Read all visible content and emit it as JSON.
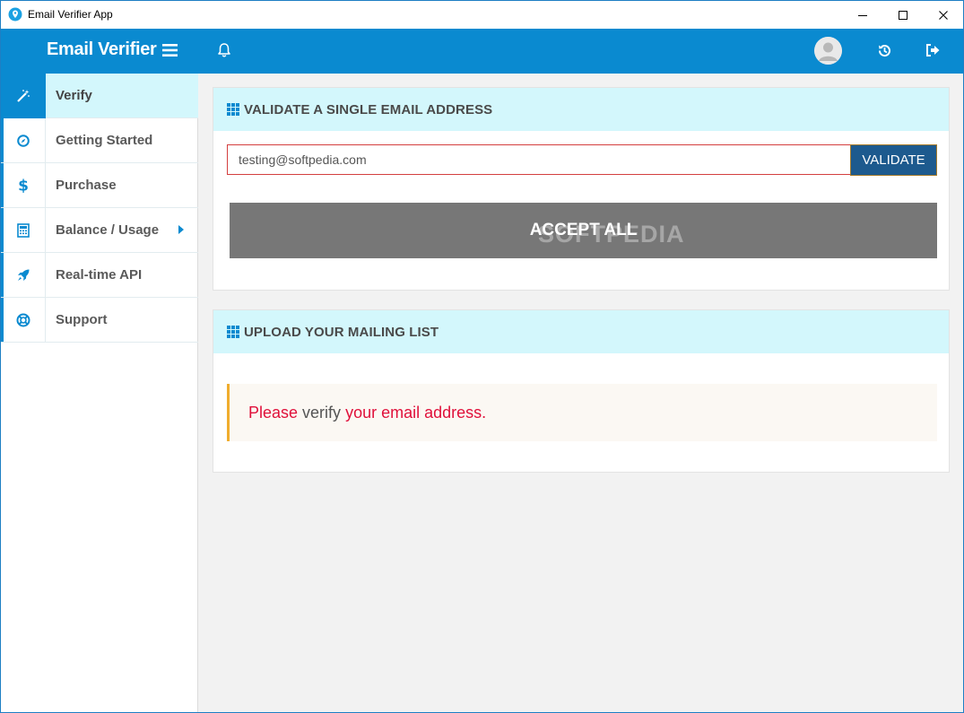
{
  "window": {
    "title": "Email Verifier App"
  },
  "header": {
    "brand": "Email Verifier"
  },
  "sidebar": {
    "items": [
      {
        "label": "Verify",
        "icon": "magic-wand-icon",
        "active": true
      },
      {
        "label": "Getting Started",
        "icon": "compass-icon"
      },
      {
        "label": "Purchase",
        "icon": "dollar-icon"
      },
      {
        "label": "Balance / Usage",
        "icon": "calculator-icon"
      },
      {
        "label": "Real-time API",
        "icon": "rocket-icon"
      },
      {
        "label": "Support",
        "icon": "lifebuoy-icon"
      }
    ]
  },
  "validate_panel": {
    "title": "VALIDATE A SINGLE EMAIL ADDRESS",
    "email_value": "testing@softpedia.com",
    "validate_label": "VALIDATE",
    "accept_all_label": "ACCEPT ALL",
    "watermark": "SOFTPEDIA"
  },
  "upload_panel": {
    "title": "UPLOAD YOUR MAILING LIST",
    "alert_part1": "Please ",
    "alert_part2": "verify",
    "alert_part3": " your email address."
  },
  "colors": {
    "accent": "#0a8ad0",
    "active_bg": "#d3f7fc",
    "validate_button": "#1d5a8e",
    "accept_button": "#777777",
    "alert_text": "#e0103a",
    "alert_border": "#f0ad2e"
  }
}
